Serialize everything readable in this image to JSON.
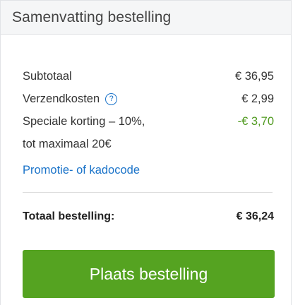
{
  "header": {
    "title": "Samenvatting bestelling"
  },
  "lines": {
    "subtotal": {
      "label": "Subtotaal",
      "value": "€ 36,95"
    },
    "shipping": {
      "label": "Verzendkosten",
      "value": "€ 2,99",
      "help_icon": "?"
    },
    "discount": {
      "label_line1": "Speciale korting – 10%,",
      "label_line2": "tot maximaal 20€",
      "value": "-€ 3,70"
    }
  },
  "promo": {
    "link_label": "Promotie- of kadocode"
  },
  "total": {
    "label": "Totaal bestelling:",
    "value": "€ 36,24"
  },
  "cta": {
    "label": "Plaats bestelling"
  },
  "colors": {
    "accent_green": "#55a321",
    "link_blue": "#1a73c9",
    "discount_green": "#4f9a1f"
  }
}
